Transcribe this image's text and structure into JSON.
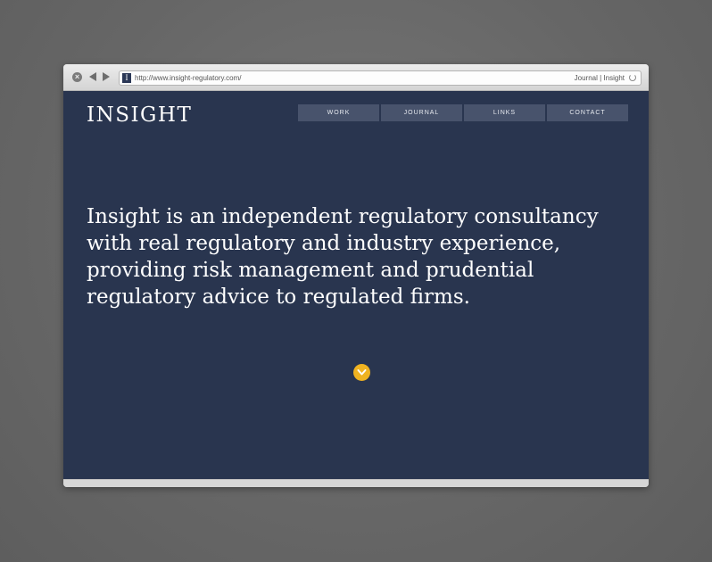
{
  "browser": {
    "url": "http://www.insight-regulatory.com/",
    "tab_title": "Journal | Insight",
    "favicon_letter": "I",
    "close_glyph": "×"
  },
  "site": {
    "logo": "INSIGHT",
    "nav": [
      {
        "label": "WORK"
      },
      {
        "label": "JOURNAL"
      },
      {
        "label": "LINKS"
      },
      {
        "label": "CONTACT"
      }
    ],
    "headline": "Insight is an independent regulatory consultancy with real regulatory and industry experience, providing risk management and prudential regulatory advice to regulated firms.",
    "scroll_icon": "chevron-down-icon"
  },
  "colors": {
    "page_background": "#29354f",
    "nav_background": "#48536c",
    "accent": "#f0b321"
  }
}
